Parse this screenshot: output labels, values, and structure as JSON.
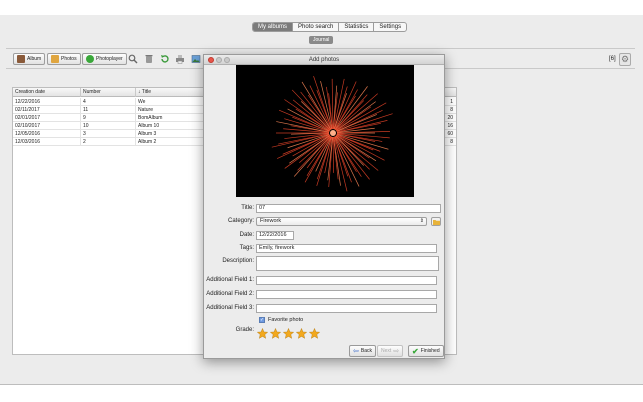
{
  "nav": {
    "tabs": [
      "My albums",
      "Photo search",
      "Statistics",
      "Settings"
    ],
    "active_tab": 0,
    "journal_label": "Journal"
  },
  "toolbar": {
    "album_label": "Album",
    "photos_label": "Photos",
    "photoplayer_label": "Photoplayer",
    "count": "[6]",
    "icons": [
      "search-icon",
      "trash-icon",
      "refresh-icon",
      "print-icon",
      "image-icon"
    ]
  },
  "table": {
    "columns": [
      "Creation date",
      "Number",
      "↓ Title"
    ],
    "rows": [
      {
        "date": "12/22/2016",
        "number": "4",
        "title": "We",
        "right": "1"
      },
      {
        "date": "02/11/2017",
        "number": "11",
        "title": "Nature",
        "right": "8"
      },
      {
        "date": "02/01/2017",
        "number": "9",
        "title": "BomAlbum",
        "right": "20"
      },
      {
        "date": "02/10/2017",
        "number": "10",
        "title": "Album 10",
        "right": "16"
      },
      {
        "date": "12/05/2016",
        "number": "3",
        "title": "Album 3",
        "right": "60"
      },
      {
        "date": "12/03/2016",
        "number": "2",
        "title": "Album 2",
        "right": "8"
      }
    ]
  },
  "dialog": {
    "title": "Add photos",
    "fields": {
      "title_label": "Title:",
      "title_value": "07",
      "category_label": "Category:",
      "category_value": "Firework",
      "date_label": "Date:",
      "date_value": "12/22/2016",
      "tags_label": "Tags:",
      "tags_value": "Emily, firework",
      "description_label": "Description:",
      "description_value": "",
      "af1_label": "Additional Field 1:",
      "af1_value": "",
      "af2_label": "Additional Field 2:",
      "af2_value": "",
      "af3_label": "Additional Field 3:",
      "af3_value": ""
    },
    "favorite_label": "Favorite photo",
    "favorite_checked": true,
    "grade_label": "Grade:",
    "grade_value": 5,
    "grade_max": 5,
    "back_label": "Back",
    "next_label": "Next",
    "finished_label": "Finished"
  },
  "colors": {
    "active_tab": "#7c7c7c",
    "star": "#f2a81d",
    "firework": "#e8452a",
    "finished_check": "#3aa83a"
  }
}
